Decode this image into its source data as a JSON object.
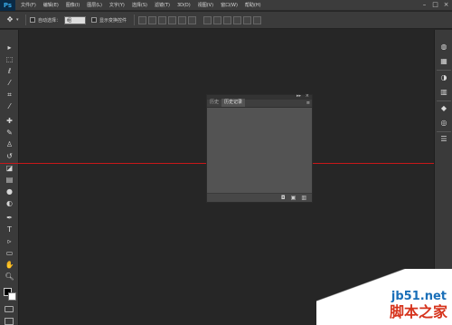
{
  "app": {
    "logo": "Ps"
  },
  "menubar": {
    "items": [
      "文件(F)",
      "编辑(E)",
      "图像(I)",
      "图层(L)",
      "文字(Y)",
      "选择(S)",
      "滤镜(T)",
      "3D(D)",
      "视图(V)",
      "窗口(W)",
      "帮助(H)"
    ],
    "window_controls": {
      "minimize": "–",
      "maximize": "□",
      "close": "×"
    }
  },
  "optionsbar": {
    "tool_icon": "move-tool-icon",
    "auto_select_label": "自动选择：",
    "auto_select_value": "组",
    "show_transform_label": "显示变换控件"
  },
  "history_panel": {
    "tabs": [
      "历史",
      "历史记录"
    ],
    "active_tab": "历史记录",
    "menu_glyph": "≡",
    "footer_buttons": [
      "new-snapshot",
      "new-document",
      "delete"
    ]
  },
  "colors": {
    "foreground": "#000000",
    "background": "#ffffff",
    "guide": "#c8171a"
  },
  "watermark": {
    "url": "jb51.net",
    "text": "脚本之家"
  }
}
